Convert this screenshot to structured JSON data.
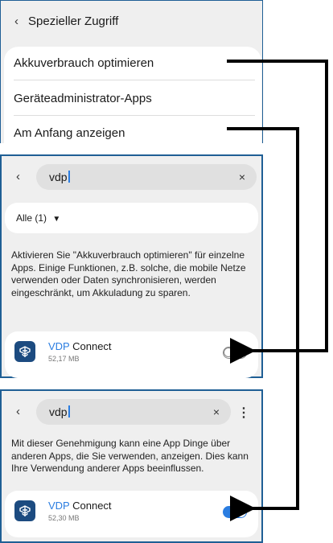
{
  "panel1": {
    "title": "Spezieller Zugriff",
    "items": [
      {
        "label": "Akkuverbrauch optimieren"
      },
      {
        "label": "Geräteadministrator-Apps"
      },
      {
        "label": "Am Anfang anzeigen"
      }
    ]
  },
  "panel2": {
    "search_value": "vdp",
    "filter_label": "Alle (1)",
    "description": "Aktivieren Sie \"Akkuverbrauch optimieren\" für einzelne Apps. Einige Funktionen, z.B. solche, die mobile Netze verwenden oder Daten synchronisieren, werden eingeschränkt, um Akkuladung zu sparen.",
    "app": {
      "name_highlight": "VDP",
      "name_rest": " Connect",
      "size": "52,17 MB",
      "toggle_state": "off"
    }
  },
  "panel3": {
    "search_value": "vdp",
    "description": "Mit dieser Genehmigung kann eine App Dinge über anderen Apps, die Sie verwenden, anzeigen. Dies kann Ihre Verwendung anderer Apps beeinflussen.",
    "app": {
      "name_highlight": "VDP",
      "name_rest": " Connect",
      "size": "52,30 MB",
      "toggle_state": "on"
    }
  },
  "icons": {
    "back": "‹",
    "close": "×",
    "more": "⋮",
    "dropdown": "▼"
  },
  "colors": {
    "accent": "#2a7de1",
    "frame": "#1f5f95",
    "app_icon_bg": "#1c4b80"
  }
}
